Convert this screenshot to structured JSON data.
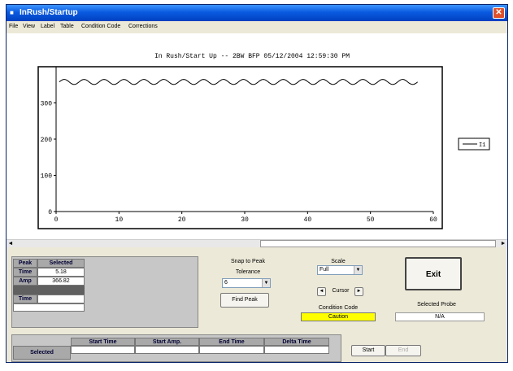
{
  "window": {
    "title": "InRush/Startup",
    "close_glyph": "✕"
  },
  "menu": {
    "items": [
      "File",
      "View",
      "Label",
      "Table",
      "Condition Code",
      "Corrections"
    ]
  },
  "chart_data": {
    "type": "line",
    "title": "In Rush/Start Up -- 2BW BFP 05/12/2004 12:59:30 PM",
    "x_ticks": [
      "0",
      "10",
      "20",
      "30",
      "40",
      "50",
      "60"
    ],
    "y_ticks": [
      "0",
      "100",
      "200",
      "300"
    ],
    "xlim": [
      0,
      60
    ],
    "ylim": [
      0,
      400
    ],
    "series": [
      {
        "name": "I1",
        "baseline": 358,
        "ripple": 7,
        "cycles": 18
      }
    ],
    "line_color": "#000000"
  },
  "scroll": {
    "left_glyph": "◄",
    "right_glyph": "►"
  },
  "peak_table": {
    "headers": [
      "Peak",
      "Selected"
    ],
    "rows": [
      {
        "label": "Time",
        "value": "5.18"
      },
      {
        "label": "Amp",
        "value": "366.82"
      }
    ],
    "time_label": "Time"
  },
  "snap": {
    "title": "Snap to Peak",
    "tolerance_label": "Tolerance",
    "tolerance_value": "6",
    "find_button": "Find Peak"
  },
  "scale": {
    "title": "Scale",
    "value": "Full",
    "cursor_label": "Cursor",
    "left_glyph": "◄",
    "right_glyph": "►"
  },
  "condition": {
    "label": "Condition Code",
    "value": "Caution",
    "color": "#ffff00"
  },
  "exit_button": "Exit",
  "probe": {
    "label": "Selected Probe",
    "value": "N/A"
  },
  "range_table": {
    "headers": [
      "Start Time",
      "Start Amp.",
      "End Time",
      "Delta Time"
    ],
    "row_label": "Selected",
    "values": [
      "",
      "",
      "",
      ""
    ]
  },
  "buttons": {
    "start": "Start",
    "end": "End"
  }
}
